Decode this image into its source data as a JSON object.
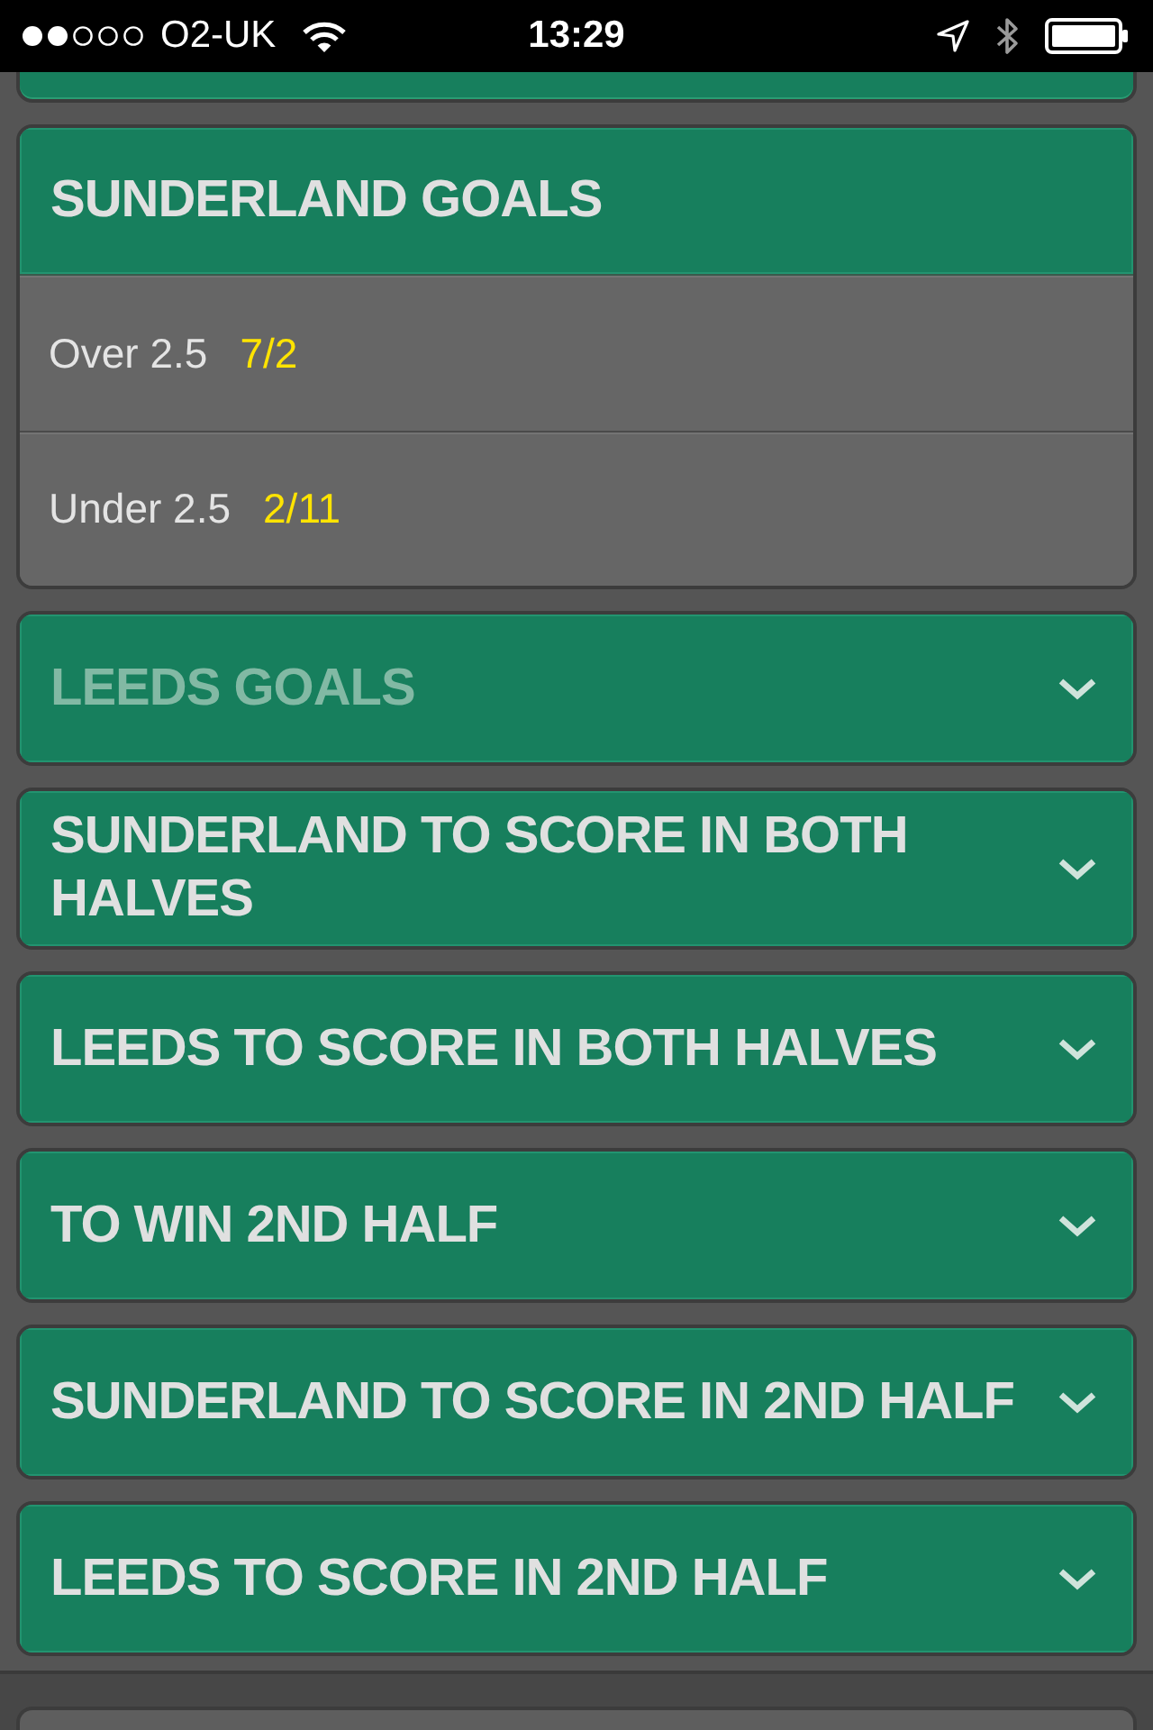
{
  "status_bar": {
    "carrier": "O2-UK",
    "time": "13:29"
  },
  "markets": [
    {
      "title": "SUNDERLAND GOALS",
      "expanded": true,
      "disabled": false,
      "selections": [
        {
          "name": "Over 2.5",
          "odds": "7/2"
        },
        {
          "name": "Under 2.5",
          "odds": "2/11"
        }
      ]
    },
    {
      "title": "LEEDS GOALS",
      "expanded": false,
      "disabled": true
    },
    {
      "title": "SUNDERLAND TO SCORE IN BOTH HALVES",
      "expanded": false,
      "disabled": false
    },
    {
      "title": "LEEDS TO SCORE IN BOTH HALVES",
      "expanded": false,
      "disabled": false
    },
    {
      "title": "TO WIN 2ND HALF",
      "expanded": false,
      "disabled": false
    },
    {
      "title": "SUNDERLAND TO SCORE IN 2ND HALF",
      "expanded": false,
      "disabled": false
    },
    {
      "title": "LEEDS TO SCORE IN 2ND HALF",
      "expanded": false,
      "disabled": false
    }
  ]
}
